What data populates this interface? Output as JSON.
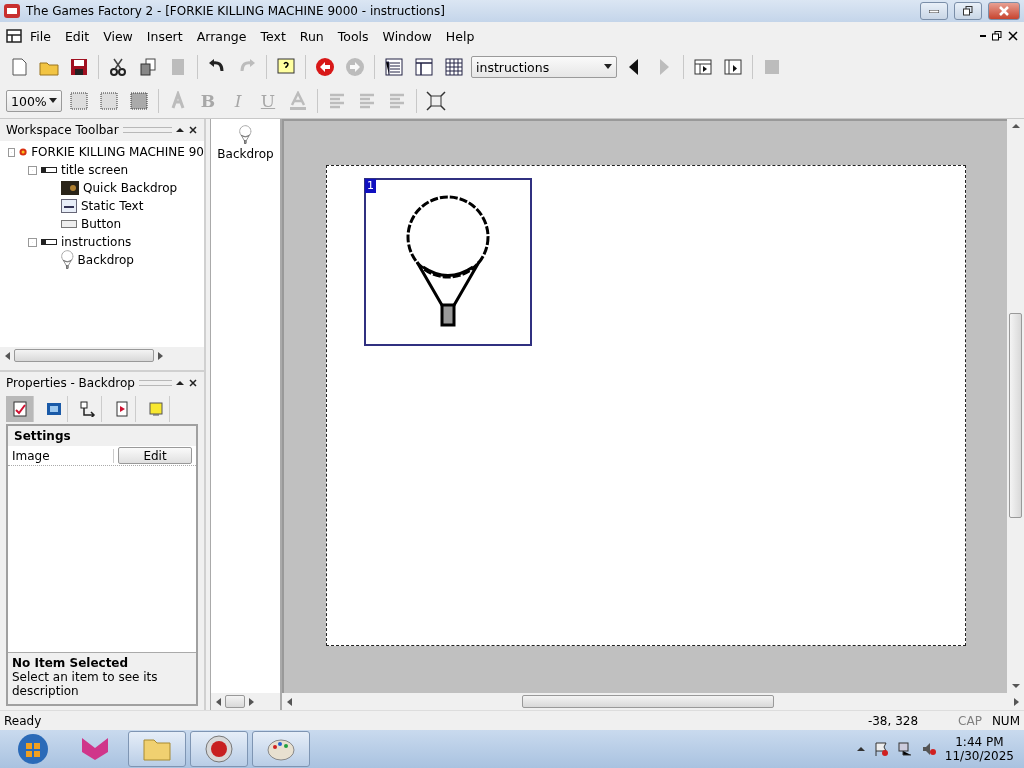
{
  "window": {
    "title": "The Games Factory 2 - [FORKIE KILLING MACHINE 9000 - instructions]"
  },
  "menu": [
    "File",
    "Edit",
    "View",
    "Insert",
    "Arrange",
    "Text",
    "Run",
    "Tools",
    "Window",
    "Help"
  ],
  "toolbar_1": [
    {
      "kind": "new",
      "disabled": false
    },
    {
      "kind": "open",
      "disabled": false
    },
    {
      "kind": "save",
      "disabled": false
    },
    {
      "kind": "sep"
    },
    {
      "kind": "cut",
      "disabled": false
    },
    {
      "kind": "copy",
      "disabled": false
    },
    {
      "kind": "paste",
      "disabled": true
    },
    {
      "kind": "sep"
    },
    {
      "kind": "undo",
      "disabled": false
    },
    {
      "kind": "redo",
      "disabled": true
    },
    {
      "kind": "sep"
    },
    {
      "kind": "help",
      "disabled": false
    },
    {
      "kind": "sep"
    },
    {
      "kind": "back",
      "disabled": false
    },
    {
      "kind": "forward",
      "disabled": true
    },
    {
      "kind": "sep"
    },
    {
      "kind": "storyboard",
      "disabled": false
    },
    {
      "kind": "frame-editor",
      "disabled": false
    },
    {
      "kind": "event-editor",
      "disabled": false
    },
    {
      "kind": "select",
      "value": "instructions"
    },
    {
      "kind": "prev",
      "disabled": false
    },
    {
      "kind": "next",
      "disabled": true
    },
    {
      "kind": "sep"
    },
    {
      "kind": "run-app",
      "disabled": false
    },
    {
      "kind": "run-frame",
      "disabled": false
    },
    {
      "kind": "sep"
    },
    {
      "kind": "stop",
      "disabled": true
    }
  ],
  "toolbar_2": [
    {
      "kind": "select",
      "value": "100%"
    },
    {
      "kind": "grid-a",
      "disabled": false
    },
    {
      "kind": "grid-b",
      "disabled": false
    },
    {
      "kind": "grid-c",
      "disabled": false
    },
    {
      "kind": "sep"
    },
    {
      "kind": "font",
      "disabled": true
    },
    {
      "kind": "bold",
      "label": "B",
      "disabled": true
    },
    {
      "kind": "italic",
      "label": "I",
      "disabled": true
    },
    {
      "kind": "underline",
      "label": "U",
      "disabled": true
    },
    {
      "kind": "color",
      "disabled": true
    },
    {
      "kind": "sep"
    },
    {
      "kind": "align-left",
      "disabled": true
    },
    {
      "kind": "align-center",
      "disabled": true
    },
    {
      "kind": "align-right",
      "disabled": true
    },
    {
      "kind": "sep"
    },
    {
      "kind": "fit",
      "disabled": false
    }
  ],
  "workspace": {
    "title": "Workspace Toolbar",
    "tree": [
      {
        "label": "FORKIE KILLING MACHINE 90",
        "kind": "application",
        "expanded": true,
        "children": [
          {
            "label": "title screen",
            "kind": "frame",
            "expanded": true,
            "children": [
              {
                "label": "Quick Backdrop",
                "kind": "quick-backdrop"
              },
              {
                "label": "Static Text",
                "kind": "static-text"
              },
              {
                "label": "Button",
                "kind": "button"
              }
            ]
          },
          {
            "label": "instructions",
            "kind": "frame",
            "expanded": true,
            "children": [
              {
                "label": "Backdrop",
                "kind": "backdrop"
              }
            ]
          }
        ]
      }
    ]
  },
  "object_list": [
    {
      "label": "Backdrop",
      "kind": "backdrop"
    }
  ],
  "properties": {
    "title": "Properties - Backdrop",
    "tabs": [
      {
        "kind": "settings",
        "selected": true
      },
      {
        "kind": "display",
        "selected": false
      },
      {
        "kind": "size",
        "selected": false
      },
      {
        "kind": "events",
        "selected": false
      },
      {
        "kind": "about",
        "selected": false
      }
    ],
    "section": "Settings",
    "rows": [
      {
        "name": "Image",
        "button": "Edit"
      }
    ],
    "help_title": "No Item Selected",
    "help_text": "Select an item to see its description"
  },
  "editor": {
    "objects": [
      {
        "number": "1",
        "kind": "backdrop",
        "selected": true
      }
    ]
  },
  "status_bar": {
    "message": "Ready",
    "coordinates": "-38, 328",
    "indicators": [
      {
        "label": "CAP",
        "on": false
      },
      {
        "label": "NUM",
        "on": true
      }
    ]
  },
  "taskbar": {
    "apps": [
      {
        "kind": "fox",
        "open": false
      },
      {
        "kind": "folder",
        "open": true
      },
      {
        "kind": "f2",
        "open": true
      },
      {
        "kind": "palette",
        "open": true
      }
    ],
    "time": "1:44 PM",
    "date": "11/30/2025"
  }
}
